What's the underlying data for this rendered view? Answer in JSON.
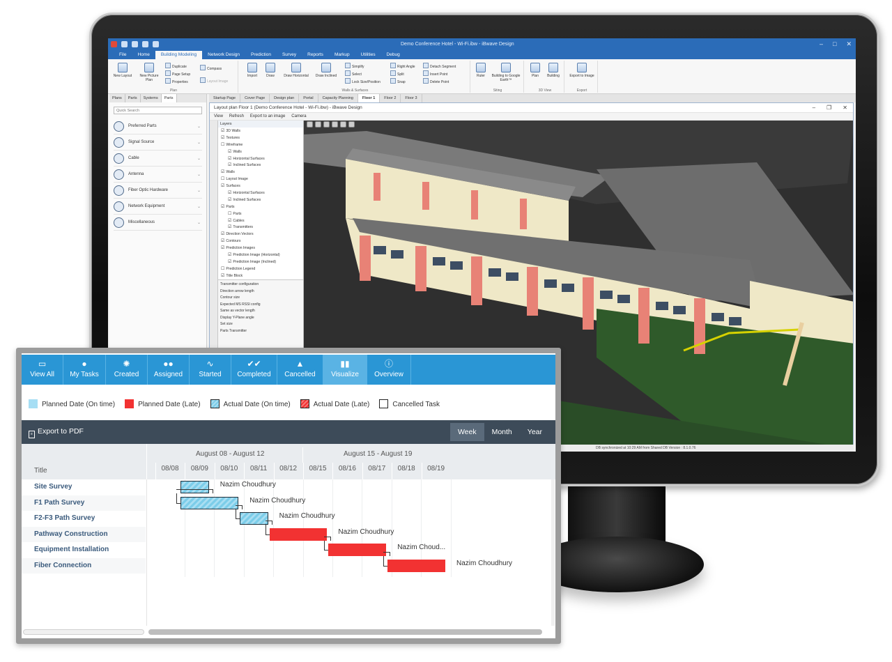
{
  "desktop": {
    "window_title": "Demo Conference Hotel - Wi-Fi.ibw - iBwave Design",
    "menu": [
      "File",
      "Home",
      "Building Modeling",
      "Network Design",
      "Prediction",
      "Survey",
      "Reports",
      "Markup",
      "Utilities",
      "Debug"
    ],
    "menu_active": "Building Modeling",
    "ribbon": {
      "plan_group": "Plan",
      "new_layout": "New Layout",
      "new_picture": "New Picture Plan",
      "duplicate": "Duplicate",
      "page_setup": "Page Setup",
      "properties": "Properties",
      "compass": "Compass",
      "layout_image": "Layout Image",
      "import": "Import",
      "draw": "Draw",
      "draw_horizontal": "Draw Horizontal",
      "draw_inclined": "Draw Inclined",
      "simplify": "Simplify",
      "select": "Select",
      "lock": "Lock Size/Position",
      "right_angle": "Right Angle",
      "split": "Split",
      "snap": "Snap",
      "detach_segment": "Detach Segment",
      "insert_point": "Insert Point",
      "delete_point": "Delete Point",
      "walls_group": "Walls & Surfaces",
      "ruler": "Ruler",
      "google_earth": "Building to Google Earth™",
      "siting_group": "Siting",
      "plan_btn": "Plan",
      "building_btn": "Building",
      "view3d_group": "3D View",
      "export_image": "Export to Image",
      "export_group": "Export"
    },
    "doc_tabs": [
      "Startup Page",
      "Cover Page",
      "Design plan",
      "Portal",
      "Capacity Planning",
      "Floor 1",
      "Floor 2",
      "Floor 3"
    ],
    "doc_tab_active": "Floor 1",
    "left_tabs": [
      "Plans",
      "Parts",
      "Systems",
      "Parts"
    ],
    "search_placeholder": "Quick Search",
    "parts": [
      "Preferred Parts",
      "Signal Source",
      "Cable",
      "Antenna",
      "Fiber Optic Hardware",
      "Network Equipment",
      "Miscellaneous"
    ],
    "subwindow_title": "Layout plan Floor 1 (Demo Conference Hotel - Wi-Fi.ibw) - iBwave Design",
    "subwindow_menu": [
      "View",
      "Refresh",
      "Export to an image",
      "Camera"
    ],
    "layers_header": "Layers",
    "layers": [
      {
        "label": "3D Walls",
        "checked": true
      },
      {
        "label": "Textures",
        "checked": true
      },
      {
        "label": "Wireframe",
        "checked": false
      },
      {
        "label": "Walls",
        "checked": true
      },
      {
        "label": "Horizontal Surfaces",
        "checked": true
      },
      {
        "label": "Inclined Surfaces",
        "checked": true
      },
      {
        "label": "Walls",
        "checked": true
      },
      {
        "label": "Layout Image",
        "checked": false
      },
      {
        "label": "Surfaces",
        "checked": true
      },
      {
        "label": "Horizontal Surfaces",
        "checked": true
      },
      {
        "label": "Inclined Surfaces",
        "checked": true
      },
      {
        "label": "Parts",
        "checked": true
      },
      {
        "label": "Parts",
        "checked": false
      },
      {
        "label": "Cables",
        "checked": true
      },
      {
        "label": "Transmitters",
        "checked": true
      },
      {
        "label": "Direction Vectors",
        "checked": true
      },
      {
        "label": "Contours",
        "checked": true
      },
      {
        "label": "Prediction Images",
        "checked": true
      },
      {
        "label": "Prediction Image (Horizontal)",
        "checked": true
      },
      {
        "label": "Prediction Image (Inclined)",
        "checked": true
      },
      {
        "label": "Prediction Legend",
        "checked": false
      },
      {
        "label": "Title Block",
        "checked": true
      }
    ],
    "config_lines": [
      "Transmitter configuration",
      "Direction arrow length",
      "Contour size",
      "Expected MS RSSI config",
      "Same as vector length",
      "Display Y-Plane angle",
      "Set size",
      "Parts                    Transmitter"
    ],
    "status": "DB synchronized at 10:29 AM from Shared DB    Version : 8.1.0.76"
  },
  "tasks": {
    "nav": [
      {
        "label": "View All",
        "icon": "inbox-icon",
        "glyph": "▭"
      },
      {
        "label": "My Tasks",
        "icon": "user-icon",
        "glyph": "●"
      },
      {
        "label": "Created",
        "icon": "lightbulb-icon",
        "glyph": "✺"
      },
      {
        "label": "Assigned",
        "icon": "users-icon",
        "glyph": "●●"
      },
      {
        "label": "Started",
        "icon": "pulse-icon",
        "glyph": "∿"
      },
      {
        "label": "Completed",
        "icon": "double-check-icon",
        "glyph": "✔✔"
      },
      {
        "label": "Cancelled",
        "icon": "warning-icon",
        "glyph": "▲"
      },
      {
        "label": "Visualize",
        "icon": "bar-chart-icon",
        "glyph": "▮▮"
      },
      {
        "label": "Overview",
        "icon": "info-icon",
        "glyph": "ⓘ"
      }
    ],
    "nav_active": "Visualize",
    "legend": [
      {
        "label": "Planned Date (On time)",
        "color": "#a6def4",
        "style": "fill"
      },
      {
        "label": "Planned Date (Late)",
        "color": "#f23232",
        "style": "fill"
      },
      {
        "label": "Actual Date (On time)",
        "color": "#7ccde9",
        "style": "hatch"
      },
      {
        "label": "Actual Date (Late)",
        "color": "#f23232",
        "style": "hatch"
      },
      {
        "label": "Cancelled Task",
        "color": "#ffffff",
        "style": "outline"
      }
    ],
    "export_label": "Export to PDF",
    "scales": [
      "Week",
      "Month",
      "Year"
    ],
    "scale_active": "Week",
    "title_header": "Title",
    "week_ranges": [
      "August 08 - August 12",
      "August 15 - August 19"
    ],
    "days": [
      "08/08",
      "08/09",
      "08/10",
      "08/11",
      "08/12",
      "08/15",
      "08/16",
      "08/17",
      "08/18",
      "08/19"
    ],
    "rows": [
      {
        "title": "Site Survey",
        "assignee": "Nazim Choudhury",
        "start": 1,
        "span": 1,
        "status": "actual"
      },
      {
        "title": "F1 Path Survey",
        "assignee": "Nazim Choudhury",
        "start": 1,
        "span": 2,
        "status": "actual"
      },
      {
        "title": "F2-F3 Path Survey",
        "assignee": "Nazim Choudhury",
        "start": 3,
        "span": 1,
        "status": "actual"
      },
      {
        "title": "Pathway Construction",
        "assignee": "Nazim Choudhury",
        "start": 4,
        "span": 2,
        "status": "late"
      },
      {
        "title": "Equipment Installation",
        "assignee": "Nazim Choud...",
        "start": 6,
        "span": 2,
        "status": "late"
      },
      {
        "title": "Fiber Connection",
        "assignee": "Nazim Choudhury",
        "start": 8,
        "span": 2,
        "status": "late"
      }
    ],
    "colors": {
      "nav": "#2a96d5",
      "nav_active": "#5ab3e4",
      "toolbar": "#3d4b59",
      "late": "#f23232",
      "ontime": "#7ccde9"
    }
  }
}
